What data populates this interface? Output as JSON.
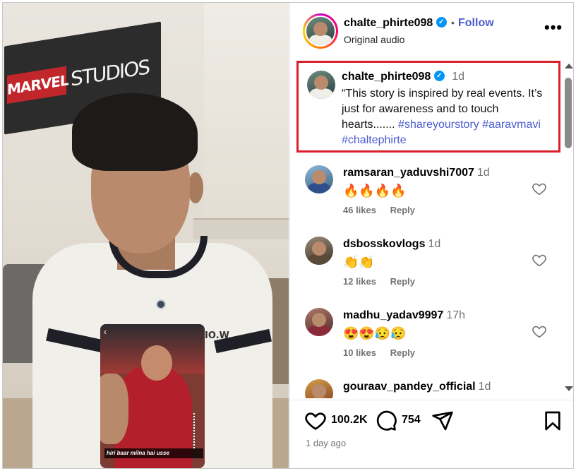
{
  "post": {
    "username": "chalte_phirte098",
    "verified_mark": "✓",
    "separator": "•",
    "follow_label": "Follow",
    "audio": "Original audio",
    "more_label": "•••"
  },
  "media": {
    "banner_left": "MARVEL",
    "banner_right": "STUDIOS",
    "shirt_text": "IO.W",
    "phone_back": "‹",
    "phone_caption": "hiri baar milna hai usse"
  },
  "caption": {
    "username": "chalte_phirte098",
    "time": "1d",
    "text": "“This story is inspired by real events. It’s just for awareness and to touch hearts.......",
    "hashtags": [
      "#shareyourstory",
      "#aaravmavi",
      "#chaltephirte"
    ]
  },
  "comments": [
    {
      "username": "ramsaran_yaduvshi7007",
      "time": "1d",
      "text": "🔥🔥🔥🔥",
      "likes": "46 likes",
      "reply": "Reply"
    },
    {
      "username": "dsbosskovlogs",
      "time": "1d",
      "text": "👏👏",
      "likes": "12 likes",
      "reply": "Reply"
    },
    {
      "username": "madhu_yadav9997",
      "time": "17h",
      "text": "😍😍😥😥",
      "likes": "10 likes",
      "reply": "Reply"
    },
    {
      "username": "gouraav_pandey_official",
      "time": "1d",
      "text": "",
      "likes": "",
      "reply": ""
    }
  ],
  "actions": {
    "likes_count": "100.2K",
    "comments_count": "754"
  },
  "posted_ago": "1 day ago",
  "colors": {
    "link": "#4a5bd0",
    "verified": "#0095f6",
    "highlight_border": "#d9202a",
    "muted": "#737373"
  }
}
